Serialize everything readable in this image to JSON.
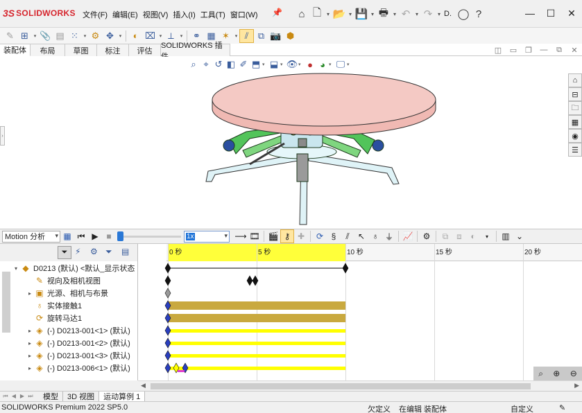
{
  "app": {
    "logo_mark": "3S",
    "logo_text": "SOLIDWORKS"
  },
  "menu": [
    "文件(F)",
    "编辑(E)",
    "视图(V)",
    "插入(I)",
    "工具(T)",
    "窗口(W)"
  ],
  "quick_access": {
    "search_hint": "D."
  },
  "tabs": [
    {
      "label": "装配体",
      "width": 44,
      "active": true
    },
    {
      "label": "布局",
      "width": 50,
      "active": false
    },
    {
      "label": "草图",
      "width": 46,
      "active": false
    },
    {
      "label": "标注",
      "width": 46,
      "active": false
    },
    {
      "label": "评估",
      "width": 46,
      "active": false
    },
    {
      "label": "SOLIDWORKS 插件",
      "width": 100,
      "active": false
    }
  ],
  "motion": {
    "study_type": "Motion 分析",
    "playback_speed": "1x"
  },
  "timeline": {
    "ticks": [
      {
        "label": "0 秒",
        "sec": 0
      },
      {
        "label": "5 秒",
        "sec": 5
      },
      {
        "label": "10 秒",
        "sec": 10
      },
      {
        "label": "15 秒",
        "sec": 15
      },
      {
        "label": "20 秒",
        "sec": 20
      }
    ]
  },
  "tree": [
    {
      "label": "D0213 (默认) <默认_显示状态",
      "indent": 0,
      "expander": "▾",
      "icon": "assembly-icon",
      "glyph": "◆"
    },
    {
      "label": "视向及相机视图",
      "indent": 1,
      "expander": "",
      "icon": "camera-icon",
      "glyph": "✎"
    },
    {
      "label": "光源、相机与布景",
      "indent": 1,
      "expander": "▸",
      "icon": "lights-icon",
      "glyph": "▣"
    },
    {
      "label": "实体接触1",
      "indent": 1,
      "expander": "",
      "icon": "contact-icon",
      "glyph": "♁"
    },
    {
      "label": "旋转马达1",
      "indent": 1,
      "expander": "",
      "icon": "motor-icon",
      "glyph": "⟳"
    },
    {
      "label": "(-) D0213-001<1> (默认)",
      "indent": 1,
      "expander": "▸",
      "icon": "part-icon",
      "glyph": "◈"
    },
    {
      "label": "(-) D0213-001<2> (默认)",
      "indent": 1,
      "expander": "▸",
      "icon": "part-icon",
      "glyph": "◈"
    },
    {
      "label": "(-) D0213-001<3> (默认)",
      "indent": 1,
      "expander": "▸",
      "icon": "part-icon",
      "glyph": "◈"
    },
    {
      "label": "(-) D0213-006<1> (默认)",
      "indent": 1,
      "expander": "▸",
      "icon": "part-icon",
      "glyph": "◈"
    }
  ],
  "bottom_tabs": [
    {
      "label": "模型",
      "active": false
    },
    {
      "label": "3D 视图",
      "active": false
    },
    {
      "label": "运动算例 1",
      "active": true
    }
  ],
  "status": {
    "product": "SOLIDWORKS Premium 2022 SP5.0",
    "state1": "欠定义",
    "state2": "在编辑 装配体",
    "units": "自定义"
  },
  "colors": {
    "brand": "#d6252d",
    "timeline_highlight": "#ffff3a",
    "motor_bar": "#c9a93f",
    "tabletop": "#f4c9c4",
    "mechanism": "#52c45a"
  }
}
